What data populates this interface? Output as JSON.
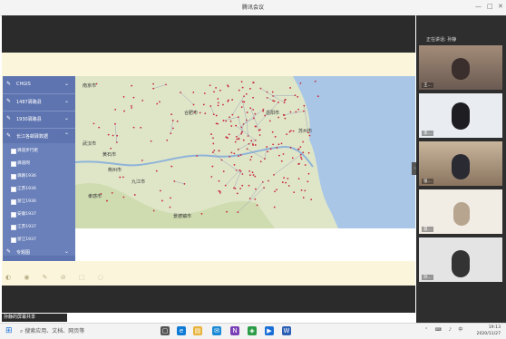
{
  "window": {
    "title": "腾讯会议"
  },
  "sidebar": {
    "items": [
      {
        "label": "CHGIS"
      },
      {
        "label": "1487驿路县"
      },
      {
        "label": "1930驿路县"
      },
      {
        "label": "长江各邮驿数据"
      },
      {
        "label": "专题图"
      }
    ],
    "sub_items": [
      {
        "label": "驿道步行距"
      },
      {
        "label": "驿道网"
      },
      {
        "label": "驿路1936"
      },
      {
        "label": "江苏1936"
      },
      {
        "label": "浙江1936"
      },
      {
        "label": "安徽1937"
      },
      {
        "label": "江苏1937"
      },
      {
        "label": "浙江1937"
      }
    ]
  },
  "map": {
    "labels": [
      "南京市",
      "武汉市",
      "合肥市",
      "苏州市",
      "黄石市",
      "九江市",
      "景德镇市",
      "孝感市",
      "荆州市",
      "岳阳市"
    ]
  },
  "participants": {
    "header": "正在讲话: 孙静",
    "tiles": [
      {
        "name": "王..."
      },
      {
        "name": "李..."
      },
      {
        "name": "张..."
      },
      {
        "name": "聂..."
      },
      {
        "name": "孙..."
      }
    ]
  },
  "share_label": "孙静的屏幕共享",
  "taskbar": {
    "search_placeholder": "搜索应用、文档、网页等",
    "time": "19:13",
    "date": "2020/11/27"
  },
  "colors": {
    "sidebar": "#5e74b0",
    "slide_bg": "#fbf5dc",
    "road": "#c8283c",
    "sea": "#a9c6e6"
  }
}
